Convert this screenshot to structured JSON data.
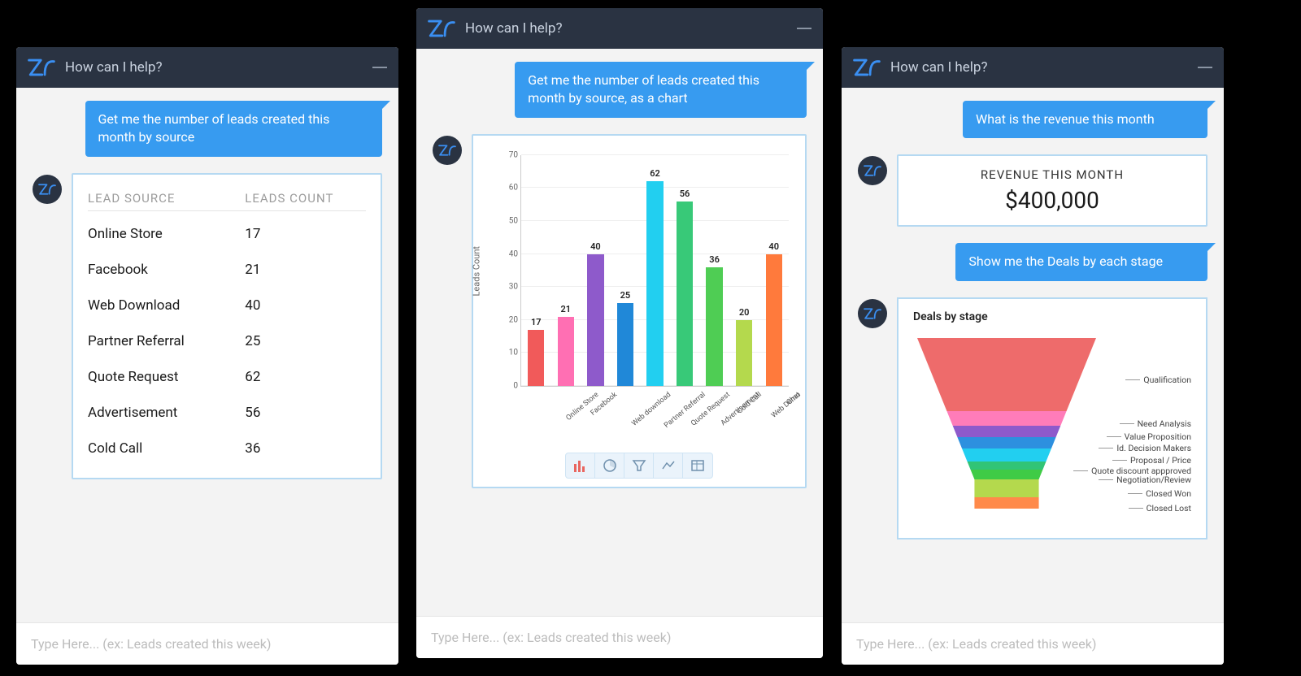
{
  "panels": {
    "p1": {
      "header": "How can I help?",
      "user_msg": "Get me the number of leads created this month by source",
      "table": {
        "col1": "LEAD SOURCE",
        "col2": "LEADS COUNT",
        "rows": [
          {
            "src": "Online Store",
            "cnt": "17"
          },
          {
            "src": "Facebook",
            "cnt": "21"
          },
          {
            "src": "Web Download",
            "cnt": "40"
          },
          {
            "src": "Partner Referral",
            "cnt": "25"
          },
          {
            "src": "Quote Request",
            "cnt": "62"
          },
          {
            "src": "Advertisement",
            "cnt": "56"
          },
          {
            "src": "Cold Call",
            "cnt": "36"
          }
        ]
      },
      "input_ph": "Type Here... (ex: Leads created this week)"
    },
    "p2": {
      "header": "How can I help?",
      "user_msg": "Get me the number of leads created this month by source, as a chart",
      "input_ph": "Type Here... (ex: Leads created this week)"
    },
    "p3": {
      "header": "How can I help?",
      "user_msg_1": "What is the revenue this month",
      "revenue": {
        "label": "REVENUE THIS MONTH",
        "value": "$400,000"
      },
      "user_msg_2": "Show me the Deals by each stage",
      "funnel_title": "Deals by stage",
      "funnel_stages": {
        "s0": "Qualification",
        "s1": "Need Analysis",
        "s2": "Value Proposition",
        "s3": "Id. Decision Makers",
        "s4": "Proposal / Price",
        "s5": "Quote discount appproved",
        "s6": "Negotiation/Review",
        "s7": "Closed Won",
        "s8": "Closed Lost"
      },
      "input_ph": "Type Here... (ex: Leads created this week)"
    }
  },
  "chart_data": [
    {
      "type": "bar",
      "title": "",
      "xlabel": "",
      "ylabel": "Leads Count",
      "ylim": [
        0,
        70
      ],
      "yticks": [
        0,
        10,
        20,
        30,
        40,
        50,
        60,
        70
      ],
      "categories": [
        "Online Store",
        "Facebook",
        "Web download",
        "Partner Referral",
        "Quote Request",
        "Advertisement",
        "Cold Call",
        "Web Demo",
        "Chat"
      ],
      "values": [
        17,
        21,
        40,
        25,
        62,
        56,
        36,
        20,
        40
      ],
      "colors": [
        "#f15a5a",
        "#ff6fb3",
        "#8e5acb",
        "#2088d8",
        "#22cff0",
        "#38c978",
        "#4fcd54",
        "#b4d94d",
        "#ff7a3c"
      ]
    },
    {
      "type": "funnel",
      "title": "Deals by stage",
      "stages": [
        "Qualification",
        "Need Analysis",
        "Value Proposition",
        "Id. Decision Makers",
        "Proposal / Price",
        "Quote discount appproved",
        "Negotiation/Review",
        "Closed Won",
        "Closed Lost"
      ],
      "colors": [
        "#ee6b6b",
        "#ff7cb9",
        "#8e5acb",
        "#2d90df",
        "#22cff0",
        "#31c476",
        "#3fcb46",
        "#b4d94d",
        "#ff8a4a"
      ]
    }
  ]
}
